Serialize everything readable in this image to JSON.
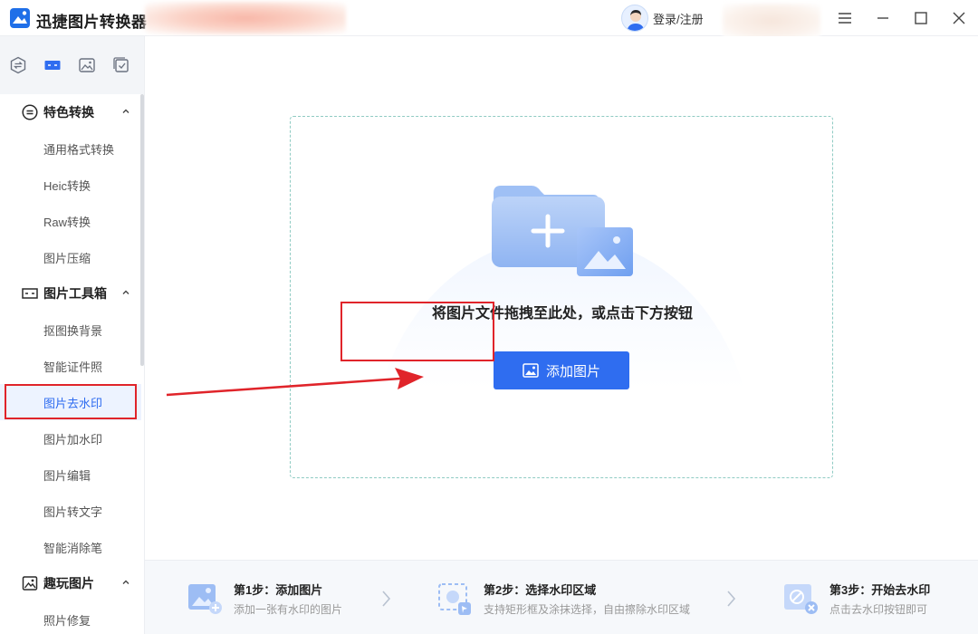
{
  "app": {
    "title": "迅捷图片转换器"
  },
  "titlebar": {
    "login_label": "登录/注册"
  },
  "sidebar": {
    "groups": [
      {
        "label": "特色转换",
        "items": [
          "通用格式转换",
          "Heic转换",
          "Raw转换",
          "图片压缩"
        ]
      },
      {
        "label": "图片工具箱",
        "items": [
          "抠图换背景",
          "智能证件照",
          "图片去水印",
          "图片加水印",
          "图片编辑",
          "图片转文字",
          "智能消除笔"
        ]
      },
      {
        "label": "趣玩图片",
        "items": [
          "照片修复"
        ]
      }
    ],
    "active_item": "图片去水印"
  },
  "dropzone": {
    "hint": "将图片文件拖拽至此处，或点击下方按钮",
    "add_button_label": "添加图片"
  },
  "steps": [
    {
      "title": "第1步：添加图片",
      "desc": "添加一张有水印的图片"
    },
    {
      "title": "第2步：选择水印区域",
      "desc": "支持矩形框及涂抹选择，自由擦除水印区域"
    },
    {
      "title": "第3步：开始去水印",
      "desc": "点击去水印按钮即可"
    }
  ],
  "colors": {
    "accent": "#2f6df0",
    "annotation": "#e0242a",
    "dashed_border": "#8fcbc3"
  }
}
